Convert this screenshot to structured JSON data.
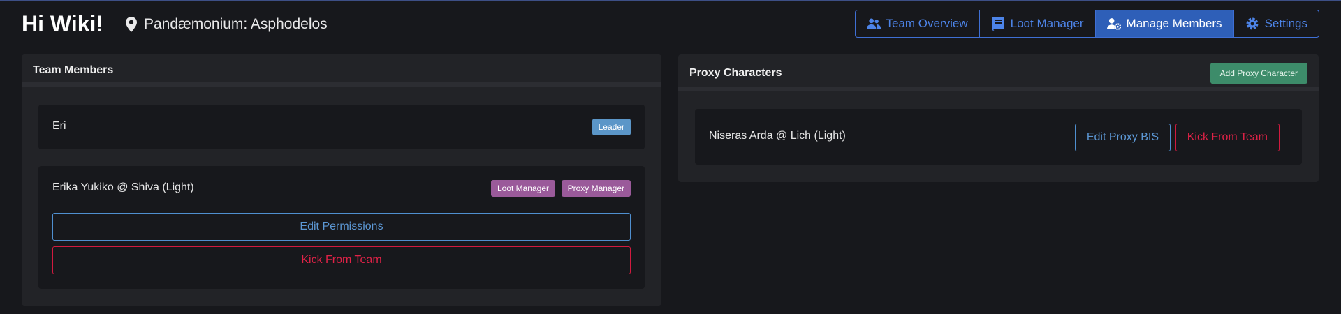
{
  "header": {
    "title": "Hi Wiki!",
    "location": "Pandæmonium: Asphodelos"
  },
  "nav": {
    "items": [
      {
        "label": "Team Overview",
        "icon": "users-icon",
        "active": false
      },
      {
        "label": "Loot Manager",
        "icon": "book-icon",
        "active": false
      },
      {
        "label": "Manage Members",
        "icon": "user-gear-icon",
        "active": true
      },
      {
        "label": "Settings",
        "icon": "gear-icon",
        "active": false
      }
    ]
  },
  "team_members": {
    "title": "Team Members",
    "members": [
      {
        "name": "Eri",
        "badges": [
          "Leader"
        ]
      },
      {
        "name": "Erika Yukiko @ Shiva (Light)",
        "badges": [
          "Loot Manager",
          "Proxy Manager"
        ],
        "edit_label": "Edit Permissions",
        "kick_label": "Kick From Team"
      }
    ]
  },
  "proxy_characters": {
    "title": "Proxy Characters",
    "add_label": "Add Proxy Character",
    "items": [
      {
        "name": "Niseras Arda @ Lich (Light)",
        "edit_label": "Edit Proxy BIS",
        "kick_label": "Kick From Team"
      }
    ]
  },
  "colors": {
    "background": "#17181c",
    "card": "#222327",
    "primary": "#3f6fd4",
    "danger": "#d11a3f",
    "info": "#4f8fcf",
    "success": "#3d8c6a",
    "badge_purple": "#9a5a9a",
    "badge_leader": "#5b96c8"
  }
}
